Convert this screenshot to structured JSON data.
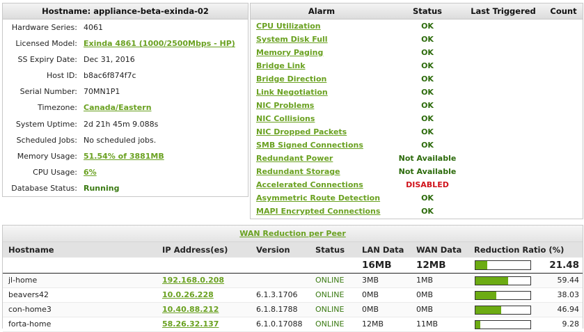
{
  "info": {
    "title": "Hostname: appliance-beta-exinda-02",
    "rows": [
      {
        "label": "Hardware Series:",
        "value": "4061",
        "link": false
      },
      {
        "label": "Licensed Model:",
        "value": "Exinda 4861 (1000/2500Mbps - HP)",
        "link": true
      },
      {
        "label": "SS Expiry Date:",
        "value": "Dec 31, 2016",
        "link": false
      },
      {
        "label": "Host ID:",
        "value": "b8ac6f874f7c",
        "link": false
      },
      {
        "label": "Serial Number:",
        "value": "70MN1P1",
        "link": false
      },
      {
        "label": "Timezone:",
        "value": "Canada/Eastern",
        "link": true
      },
      {
        "label": "System Uptime:",
        "value": "2d 21h 45m 9.088s",
        "link": false
      },
      {
        "label": "Scheduled Jobs:",
        "value": "No scheduled jobs.",
        "link": false
      },
      {
        "label": "Memory Usage:",
        "value": "51.54% of 3881MB",
        "link": true
      },
      {
        "label": "CPU Usage:",
        "value": "6%",
        "link": true
      },
      {
        "label": "Database Status:",
        "value": "Running",
        "link": false,
        "status": true
      }
    ]
  },
  "alarms": {
    "headers": {
      "alarm": "Alarm",
      "status": "Status",
      "last": "Last Triggered",
      "count": "Count"
    },
    "rows": [
      {
        "name": "CPU Utilization",
        "status": "OK",
        "kind": "ok"
      },
      {
        "name": "System Disk Full",
        "status": "OK",
        "kind": "ok"
      },
      {
        "name": "Memory Paging",
        "status": "OK",
        "kind": "ok"
      },
      {
        "name": "Bridge Link",
        "status": "OK",
        "kind": "ok"
      },
      {
        "name": "Bridge Direction",
        "status": "OK",
        "kind": "ok"
      },
      {
        "name": "Link Negotiation",
        "status": "OK",
        "kind": "ok"
      },
      {
        "name": "NIC Problems",
        "status": "OK",
        "kind": "ok"
      },
      {
        "name": "NIC Collisions",
        "status": "OK",
        "kind": "ok"
      },
      {
        "name": "NIC Dropped Packets",
        "status": "OK",
        "kind": "ok"
      },
      {
        "name": "SMB Signed Connections",
        "status": "OK",
        "kind": "ok"
      },
      {
        "name": "Redundant Power",
        "status": "Not Available",
        "kind": "na"
      },
      {
        "name": "Redundant Storage",
        "status": "Not Available",
        "kind": "na"
      },
      {
        "name": "Accelerated Connections",
        "status": "DISABLED",
        "kind": "dis"
      },
      {
        "name": "Asymmetric Route Detection",
        "status": "OK",
        "kind": "ok"
      },
      {
        "name": "MAPI Encrypted Connections",
        "status": "OK",
        "kind": "ok"
      }
    ]
  },
  "wan": {
    "title": "WAN Reduction per Peer",
    "headers": {
      "hostname": "Hostname",
      "ip": "IP Address(es)",
      "version": "Version",
      "status": "Status",
      "lan": "LAN Data",
      "wan": "WAN Data",
      "ratio": "Reduction Ratio (%)"
    },
    "total": {
      "lan": "16MB",
      "wan": "12MB",
      "ratio": "21.48",
      "ratio_value": 21.48
    },
    "rows": [
      {
        "host": "jl-home",
        "ip": "192.168.0.208",
        "version": "",
        "status": "ONLINE",
        "lan": "3MB",
        "wan": "1MB",
        "ratio": "59.44",
        "ratio_value": 59.44
      },
      {
        "host": "beavers42",
        "ip": "10.0.26.228",
        "version": "6.1.3.1706",
        "status": "ONLINE",
        "lan": "0MB",
        "wan": "0MB",
        "ratio": "38.03",
        "ratio_value": 38.03
      },
      {
        "host": "con-home3",
        "ip": "10.40.88.212",
        "version": "6.1.8.1788",
        "status": "ONLINE",
        "lan": "0MB",
        "wan": "0MB",
        "ratio": "46.94",
        "ratio_value": 46.94
      },
      {
        "host": "forta-home",
        "ip": "58.26.32.137",
        "version": "6.1.0.17088",
        "status": "ONLINE",
        "lan": "12MB",
        "wan": "11MB",
        "ratio": "9.28",
        "ratio_value": 9.28
      }
    ]
  },
  "colors": {
    "link": "#6aa121",
    "ok": "#2d6b0c",
    "disabled": "#d0131b",
    "bar_fill": "#6cab13"
  }
}
